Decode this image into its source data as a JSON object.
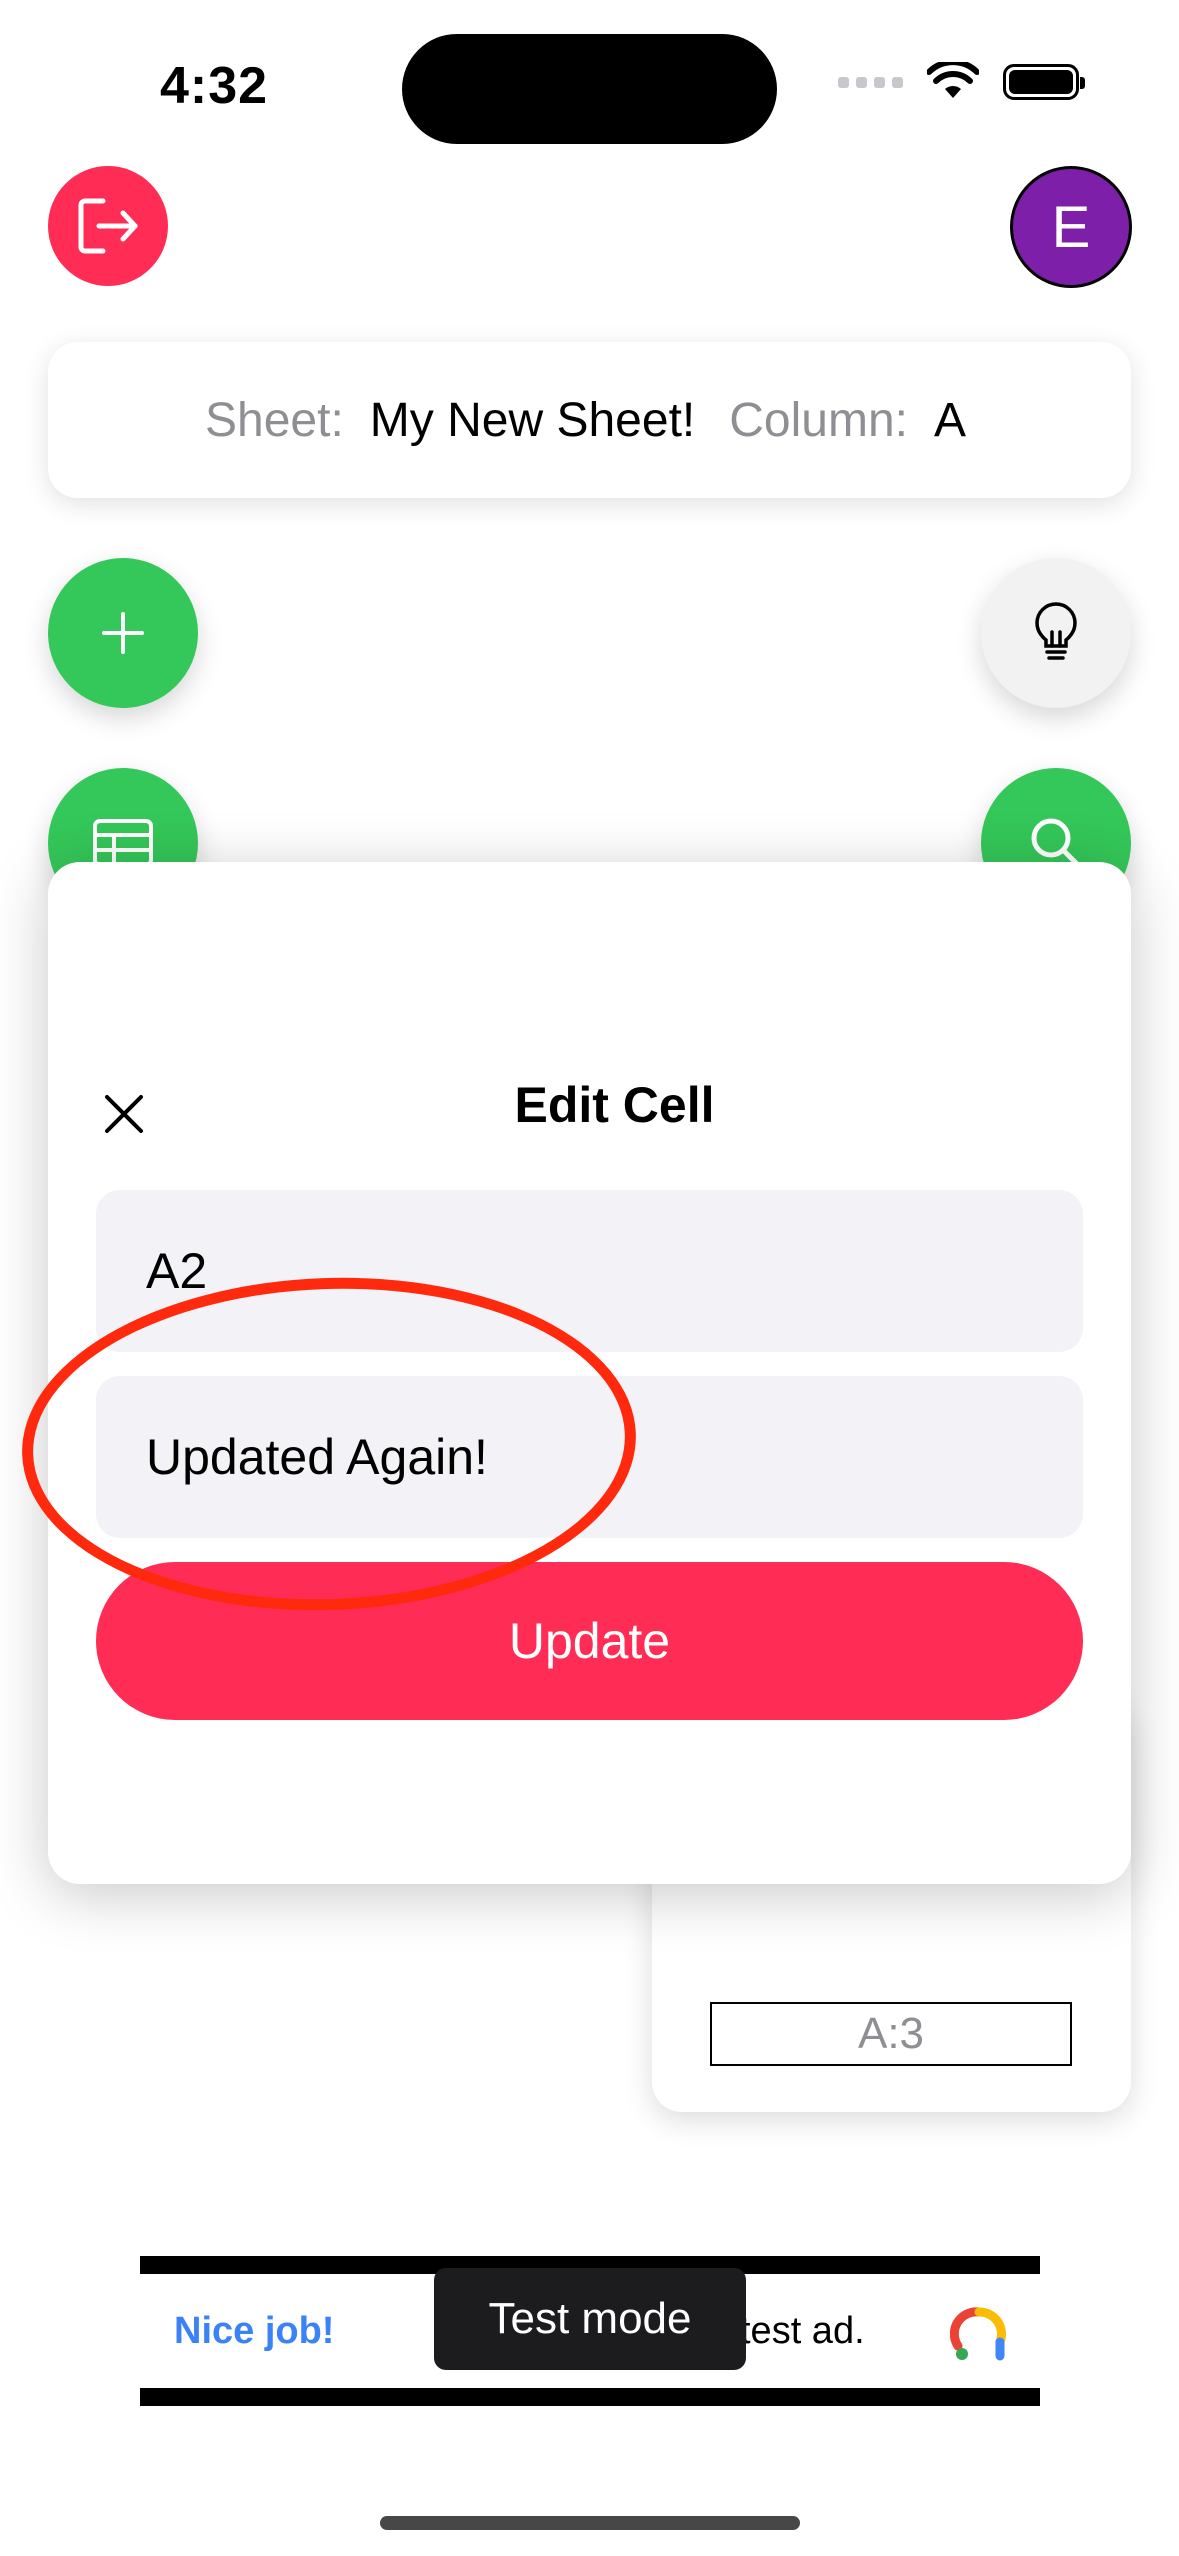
{
  "status_bar": {
    "time": "4:32"
  },
  "header": {
    "avatar_initial": "E"
  },
  "info_bar": {
    "sheet_label": "Sheet:",
    "sheet_name": "My New Sheet!",
    "column_label": "Column:",
    "column_value": "A"
  },
  "background_card": {
    "cell_label": "A:3"
  },
  "modal": {
    "title": "Edit Cell",
    "cell_field_value": "A2",
    "value_field_value": "Updated Again!",
    "update_label": "Update"
  },
  "ad": {
    "left_text": "Nice job!",
    "right_text": "test ad.",
    "badge": "Test mode"
  },
  "colors": {
    "accent_red": "#ff2d55",
    "accent_green": "#34c759",
    "avatar_purple": "#7d1fa8",
    "annotation_red": "#ff2a0d"
  },
  "icons": {
    "logout": "logout-icon",
    "add": "plus-icon",
    "table": "table-icon",
    "idea": "lightbulb-icon",
    "search": "search-icon",
    "close": "close-icon",
    "ad_logo": "adsense-logo-icon"
  }
}
